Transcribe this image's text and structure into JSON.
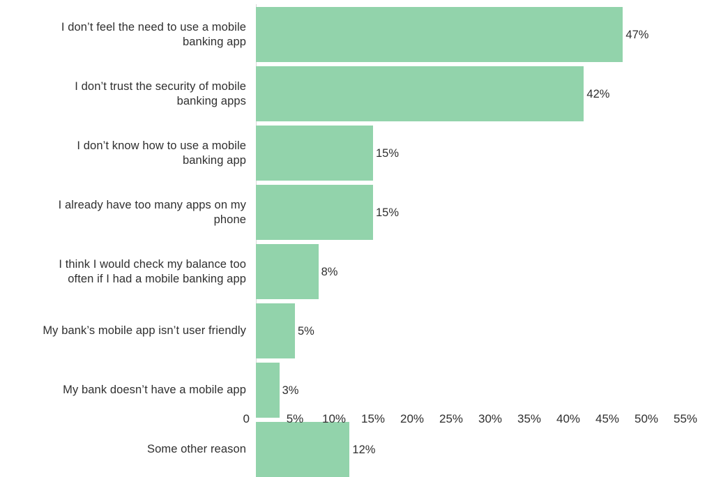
{
  "chart_data": {
    "type": "bar",
    "orientation": "horizontal",
    "title": "",
    "subtitle": "",
    "xlabel": "",
    "ylabel": "",
    "grid": false,
    "legend": null,
    "xlim": [
      0,
      57.5
    ],
    "categories": [
      "I don’t feel the need to use a mobile banking app",
      "I don’t trust the security of mobile banking apps",
      "I don’t know how to use a mobile banking app",
      "I already have too many apps on my phone",
      "I think I would check my balance too often if I had a mobile banking app",
      "My bank’s mobile app isn’t user friendly",
      "My bank doesn’t have a mobile app",
      "Some other reason"
    ],
    "category_lines": [
      [
        "I don’t feel the need to use a mobile",
        "banking app"
      ],
      [
        "I don’t trust the security of mobile",
        "banking apps"
      ],
      [
        "I don’t know how to use a mobile",
        "banking app"
      ],
      [
        "I already have too many apps on my",
        "phone"
      ],
      [
        "I think I would check my balance too",
        "often if I had a mobile banking app"
      ],
      [
        "My bank’s mobile app isn’t user friendly"
      ],
      [
        "My bank doesn’t have a mobile app"
      ],
      [
        "Some other reason"
      ]
    ],
    "values": [
      47,
      42,
      15,
      15,
      8,
      5,
      3,
      12
    ],
    "value_labels": [
      "47%",
      "42%",
      "15%",
      "15%",
      "8%",
      "5%",
      "3%",
      "12%"
    ],
    "x_ticks": [
      0,
      5,
      10,
      15,
      20,
      25,
      30,
      35,
      40,
      45,
      50,
      55
    ],
    "x_tick_labels": [
      "0",
      "5%",
      "10%",
      "15%",
      "20%",
      "25%",
      "30%",
      "35%",
      "40%",
      "45%",
      "50%",
      "55%"
    ],
    "colors": {
      "bar": "#92d3ab",
      "text": "#2f2f2f",
      "axis_line": "#d9d9d9",
      "background": "#ffffff"
    }
  }
}
